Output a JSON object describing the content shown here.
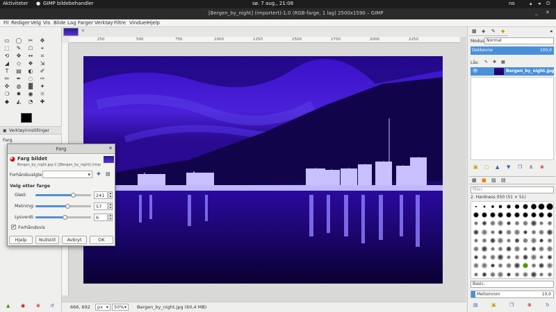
{
  "topbar": {
    "activities": "Aktiviteter",
    "app_menu": "GIMP bildebehandler",
    "clock": "sø. 7 aug., 21:08",
    "lang": "no"
  },
  "window": {
    "title": "[Bergen_by_night] (importert)-1.0 (RGB-farge, 1 lag) 2500x1590 – GIMP"
  },
  "menu": [
    "Fil",
    "Rediger",
    "Velg",
    "Vis",
    "Bilde",
    "Lag",
    "Farger",
    "Verktøy",
    "Filtre",
    "Vinduer",
    "Hjelp"
  ],
  "ruler_ticks": [
    "250",
    "500",
    "750",
    "1000",
    "1250",
    "1500",
    "1750",
    "2000",
    "2250"
  ],
  "toolbox": {
    "tool_options_tab": "Verktøyinnstillinger",
    "farg_label": "Farg"
  },
  "dialog": {
    "title": "Farg",
    "header_title": "Farg bildet",
    "header_sub": "Bergen_by_night.jpg-2 ([Bergen_by_night] (import…",
    "presets_label": "Forhåndsvalgte:",
    "section_label": "Velg etter farge",
    "sliders": [
      {
        "label": "Glød:",
        "value": "241",
        "fraction": 0.67
      },
      {
        "label": "Metning:",
        "value": "57",
        "fraction": 0.57
      },
      {
        "label": "Lysverdi:",
        "value": "6",
        "fraction": 0.53
      }
    ],
    "preview_label": "Forhåndsvis",
    "preview_checked": true,
    "buttons": {
      "help": "Hjelp",
      "reset": "Nullstill",
      "cancel": "Avbryt",
      "ok": "OK"
    }
  },
  "status": {
    "coords": "666, 692",
    "unit": "px",
    "zoom": "50%",
    "info": "Bergen_by_night.jpg (60,4 MB)"
  },
  "layers": {
    "mode_label": "Modus:",
    "mode_value": "Normal",
    "opacity_label": "Dekkevne",
    "opacity_value": "100,0",
    "lock_label": "Lås:",
    "layer_name": "Bergen_by_night.jpg"
  },
  "brushes": {
    "filter_placeholder": "filter",
    "brush_name": "2. Hardness 050 (51 × 51)",
    "preset": "Basic,",
    "spacing_label": "Mellomrom",
    "spacing_value": "10,0"
  },
  "colors": {
    "accent": "#4a90d9",
    "image_tint": "#3a10c8"
  }
}
